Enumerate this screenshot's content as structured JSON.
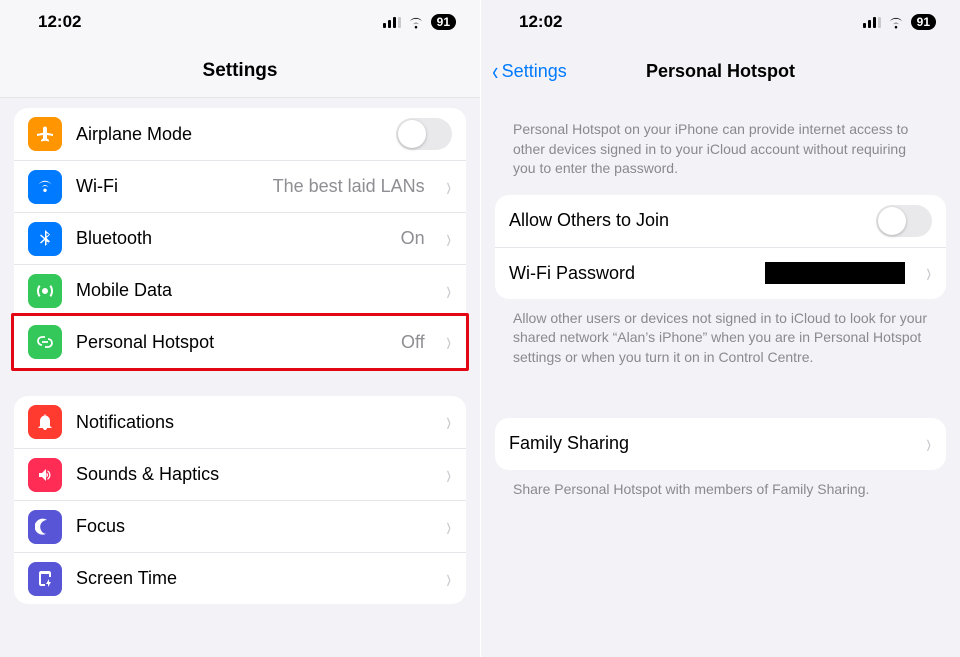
{
  "status": {
    "time": "12:02",
    "battery": "91"
  },
  "left": {
    "title": "Settings",
    "group1": [
      {
        "icon": "airplane-icon",
        "color": "#ff9500",
        "label": "Airplane Mode",
        "toggle": true
      },
      {
        "icon": "wifi-icon",
        "color": "#007aff",
        "label": "Wi-Fi",
        "value": "The best laid LANs",
        "chevron": true
      },
      {
        "icon": "bluetooth-icon",
        "color": "#007aff",
        "label": "Bluetooth",
        "value": "On",
        "chevron": true
      },
      {
        "icon": "cellular-icon",
        "color": "#34c759",
        "label": "Mobile Data",
        "chevron": true
      },
      {
        "icon": "hotspot-icon",
        "color": "#34c759",
        "label": "Personal Hotspot",
        "value": "Off",
        "chevron": true,
        "highlighted": true
      }
    ],
    "group2": [
      {
        "icon": "notifications-icon",
        "color": "#ff3b30",
        "label": "Notifications",
        "chevron": true
      },
      {
        "icon": "sounds-icon",
        "color": "#ff2d55",
        "label": "Sounds & Haptics",
        "chevron": true
      },
      {
        "icon": "focus-icon",
        "color": "#5856d6",
        "label": "Focus",
        "chevron": true
      },
      {
        "icon": "screentime-icon",
        "color": "#5856d6",
        "label": "Screen Time",
        "chevron": true
      }
    ]
  },
  "right": {
    "back": "Settings",
    "title": "Personal Hotspot",
    "intro": "Personal Hotspot on your iPhone can provide internet access to other devices signed in to your iCloud account without requiring you to enter the password.",
    "allow_label": "Allow Others to Join",
    "pwd_label": "Wi-Fi Password",
    "allow_note": "Allow other users or devices not signed in to iCloud to look for your shared network “Alan’s iPhone” when you are in Personal Hotspot settings or when you turn it on in Control Centre.",
    "family_label": "Family Sharing",
    "family_note": "Share Personal Hotspot with members of Family Sharing."
  }
}
